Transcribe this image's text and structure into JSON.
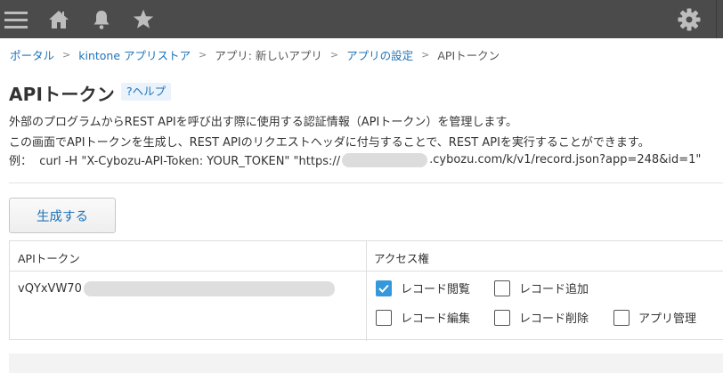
{
  "header": {
    "icons": [
      "menu-icon",
      "home-icon",
      "bell-icon",
      "star-icon",
      "gear-icon"
    ]
  },
  "breadcrumb": [
    {
      "label": "ポータル",
      "link": true
    },
    {
      "label": "kintone アプリストア",
      "link": true
    },
    {
      "label": "アプリ: 新しいアプリ",
      "link": false
    },
    {
      "label": "アプリの設定",
      "link": true
    },
    {
      "label": "APIトークン",
      "link": false
    }
  ],
  "breadcrumb_separator": ">",
  "page": {
    "title": "APIトークン",
    "help_label": "?ヘルプ",
    "description": [
      "外部のプログラムからREST APIを呼び出す際に使用する認証情報（APIトークン）を管理します。",
      "この画面でAPIトークンを生成し、REST APIのリクエストヘッダに付与することで、REST APIを実行することができます。"
    ],
    "example_prefix": "例：  curl -H \"X-Cybozu-API-Token: YOUR_TOKEN\" \"https://",
    "example_suffix": ".cybozu.com/k/v1/record.json?app=248&id=1\"",
    "generate_button": "生成する"
  },
  "table": {
    "headers": {
      "token": "APIトークン",
      "access": "アクセス権"
    },
    "row": {
      "token_prefix": "vQYxVW70",
      "permissions": {
        "view": {
          "label": "レコード閲覧",
          "checked": true
        },
        "add": {
          "label": "レコード追加",
          "checked": false
        },
        "edit": {
          "label": "レコード編集",
          "checked": false
        },
        "delete": {
          "label": "レコード削除",
          "checked": false
        },
        "admin": {
          "label": "アプリ管理",
          "checked": false
        }
      }
    }
  },
  "colors": {
    "topbar": "#4b4b4b",
    "link": "#1f73b7",
    "checkbox_checked": "#3498db"
  }
}
